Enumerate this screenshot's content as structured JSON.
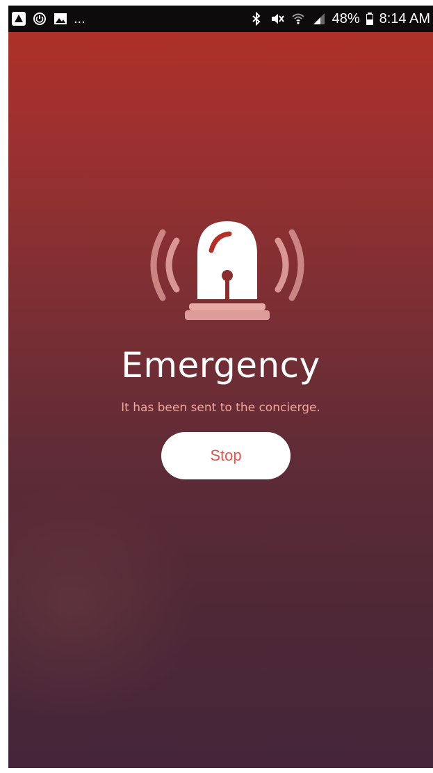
{
  "status_bar": {
    "left_icons": [
      "warning-triangle-icon",
      "power-circle-icon",
      "image-icon"
    ],
    "ellipsis": "...",
    "right_icons": [
      "bluetooth-icon",
      "mute-icon",
      "wifi-icon",
      "signal-icon"
    ],
    "battery_percent": "48%",
    "battery_icon": "battery-icon",
    "time": "8:14 AM"
  },
  "emergency": {
    "icon": "siren-icon",
    "title": "Emergency",
    "subtitle": "It has been sent to the concierge.",
    "stop_label": "Stop"
  },
  "colors": {
    "background_top": "#b23027",
    "background_bottom": "#45253a",
    "subtitle": "#f1a59c",
    "button_text": "#e0574e",
    "button_bg": "#ffffff"
  }
}
